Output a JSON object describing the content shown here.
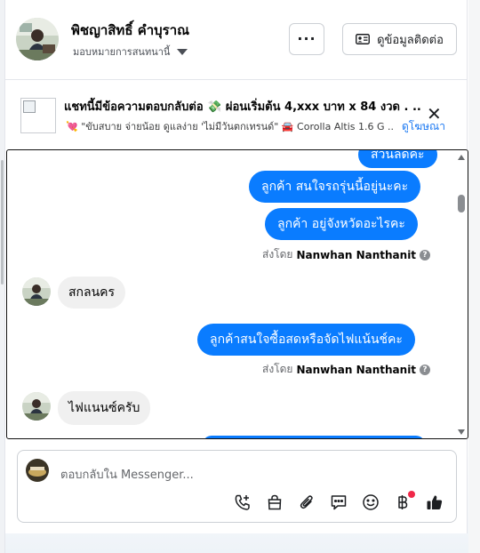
{
  "header": {
    "name": "พิชญาสิทธิ์ คำบุราณ",
    "assign_label": "มอบหมายการสนทนานี้",
    "more_label": "···",
    "contact_button": "ดูข้อมูลติดต่อ"
  },
  "ad": {
    "title": "แชทนี้มีข้อความตอบกลับต่อ 💸 ผ่อนเริ่มต้น 4,xxx บาท x 84 งวด . ..",
    "subtitle": "💘 \"ขับสบาย จ่ายน้อย ดูแลง่าย 'ไม่มีวันตกเทรนด์\" 🚘 Corolla Altis 1.6 G ...",
    "link": "ดูโฆษณา",
    "close": "✕"
  },
  "messages": {
    "partial_top": "ส่วนลดคะ",
    "out1": "ลูกค้า  สนใจรถรุ่นนี้อยู่นะคะ",
    "out2": "ลูกค้า  อยู่จังหวัดอะไรคะ",
    "sent_by_label": "ส่งโดย",
    "sent_by_name": "Nanwhan Nanthanit",
    "in1": "สกลนคร",
    "out3": "ลูกค้าสนใจซื้อสดหรือจัดไฟแน้นช์คะ",
    "in2": "ไฟแนนซ์ครับ"
  },
  "composer": {
    "placeholder": "ตอบกลับใน Messenger..."
  },
  "colors": {
    "accent": "#0a7cff",
    "incoming_bubble": "#f0f0f0",
    "link": "#1877f2"
  }
}
